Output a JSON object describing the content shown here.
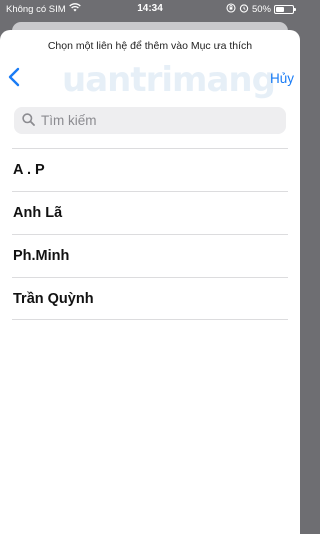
{
  "status_bar": {
    "carrier": "Không có SIM",
    "time": "14:34",
    "battery": "50%",
    "battery_level": 0.5
  },
  "sheet": {
    "prompt": "Chọn một liên hệ để thêm vào Mục ưa thích",
    "cancel_label": "Hủy",
    "back_icon": "chevron-left-icon"
  },
  "watermark": {
    "text": "uantrimang"
  },
  "search": {
    "placeholder": "Tìm kiếm",
    "icon": "search-icon"
  },
  "contacts": [
    {
      "name": "A . P"
    },
    {
      "name": "Anh Lã"
    },
    {
      "name": "Ph.Minh"
    },
    {
      "name": "Trần Quỳnh"
    }
  ],
  "colors": {
    "accent": "#1a7cf5",
    "backdrop": "#6e6e72",
    "search_bg": "#eeeef0"
  }
}
